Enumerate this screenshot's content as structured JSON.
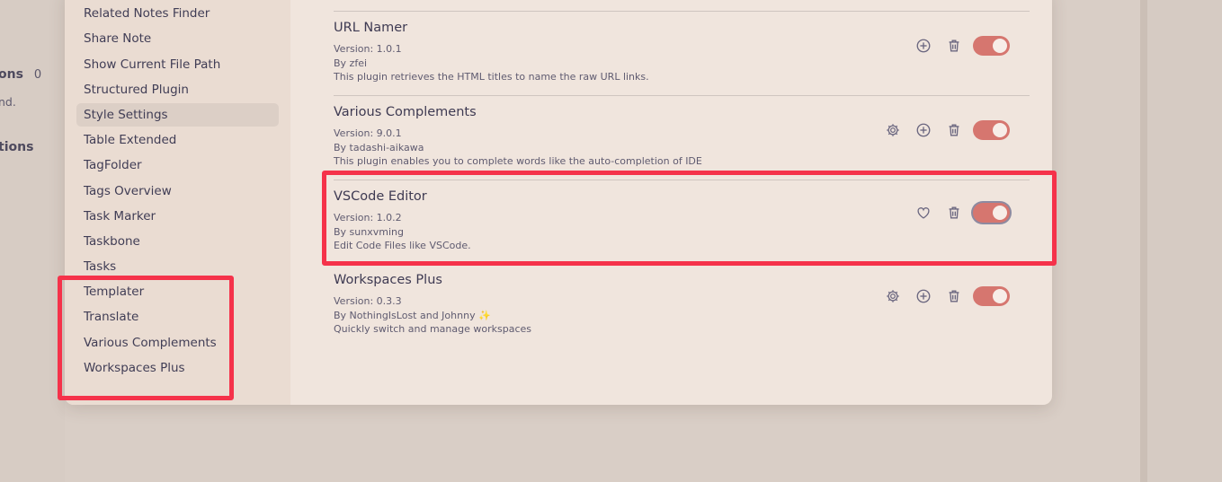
{
  "background_left": {
    "line1": "ons",
    "line1_count": "0",
    "line2": "nd.",
    "line3": "tions"
  },
  "sidebar": {
    "items": [
      {
        "label": "Related Notes Finder"
      },
      {
        "label": "Share Note"
      },
      {
        "label": "Show Current File Path"
      },
      {
        "label": "Structured Plugin"
      },
      {
        "label": "Style Settings",
        "active": true
      },
      {
        "label": "Table Extended"
      },
      {
        "label": "TagFolder"
      },
      {
        "label": "Tags Overview"
      },
      {
        "label": "Task Marker"
      },
      {
        "label": "Taskbone"
      },
      {
        "label": "Tasks"
      },
      {
        "label": "Templater"
      },
      {
        "label": "Translate"
      },
      {
        "label": "Various Complements"
      },
      {
        "label": "Workspaces Plus"
      }
    ]
  },
  "plugins": [
    {
      "name": "URL Namer",
      "version": "Version: 1.0.1",
      "author": "By zfei",
      "description": "This plugin retrieves the HTML titles to name the raw URL links.",
      "icons": [
        "plus-circle-icon",
        "trash-icon"
      ],
      "enabled": true
    },
    {
      "name": "Various Complements",
      "version": "Version: 9.0.1",
      "author": "By tadashi-aikawa",
      "description": "This plugin enables you to complete words like the auto-completion of IDE",
      "icons": [
        "gear-icon",
        "plus-circle-icon",
        "trash-icon"
      ],
      "enabled": true
    },
    {
      "name": "VSCode Editor",
      "version": "Version: 1.0.2",
      "author": "By sunxvming",
      "description": "Edit Code Files like VSCode.",
      "icons": [
        "heart-icon",
        "trash-icon"
      ],
      "enabled": true
    },
    {
      "name": "Workspaces Plus",
      "version": "Version: 0.3.3",
      "author": "By NothingIsLost and Johnny",
      "author_suffix": "✨",
      "description": "Quickly switch and manage workspaces",
      "icons": [
        "gear-icon",
        "plus-circle-icon",
        "trash-icon"
      ],
      "enabled": true
    }
  ],
  "colors": {
    "highlight": "#f5324a",
    "toggle_on": "#d6766f",
    "modal_bg": "#f0e5dd",
    "sidebar_bg": "#eadcd2"
  }
}
